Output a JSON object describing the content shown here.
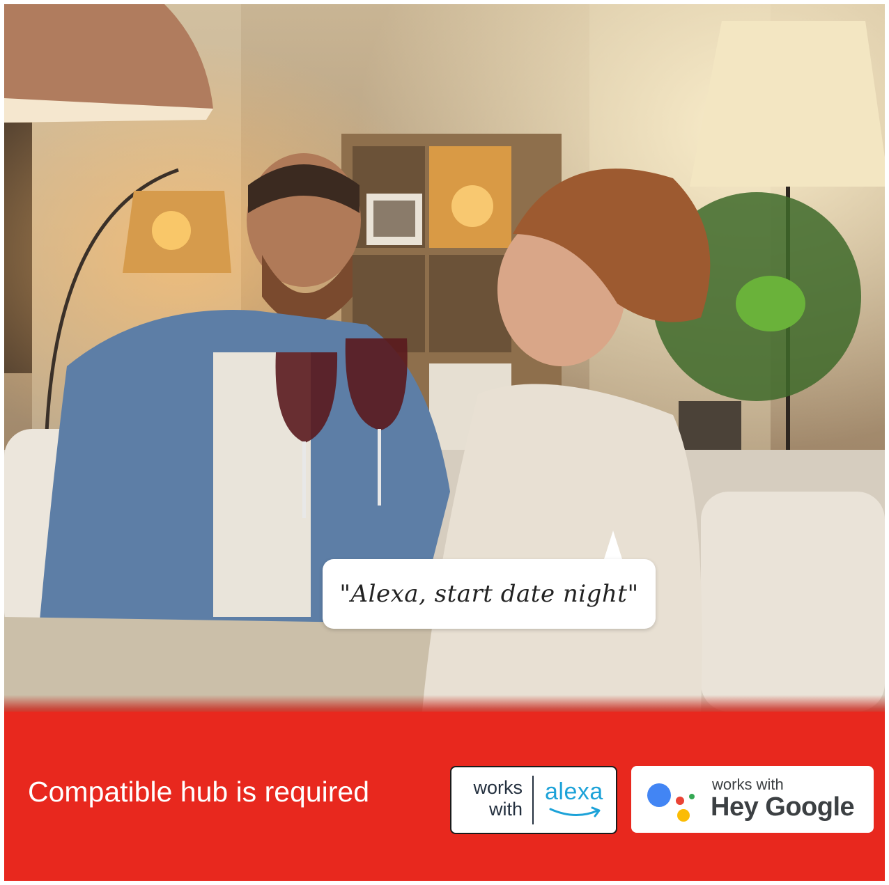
{
  "photo": {
    "speech_bubble": "\"Alexa, start date night\""
  },
  "banner": {
    "text": "Compatible hub is required",
    "background_color": "#e8281e"
  },
  "badges": {
    "alexa": {
      "works_with": "works with",
      "brand": "alexa",
      "brand_color": "#1ca2d8"
    },
    "google": {
      "works_with": "works with",
      "brand": "Hey Google"
    }
  }
}
